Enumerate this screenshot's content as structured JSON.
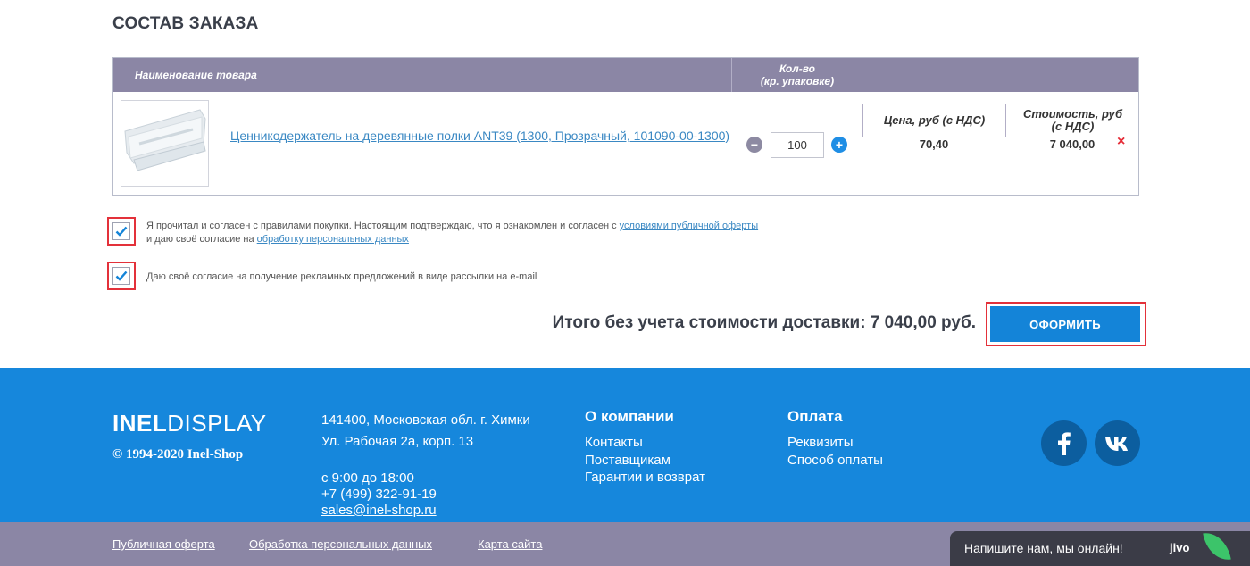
{
  "order": {
    "title": "СОСТАВ ЗАКАЗА",
    "columns": {
      "name": "Наименование товара",
      "qty": "Кол-во\n(кр. упаковке)",
      "price": "Цена, руб (с НДС)",
      "cost": "Стоимость, руб\n(с НДС)"
    },
    "items": [
      {
        "name": "Ценникодержатель на деревянные полки ANT39 (1300, Прозрачный, 101090-00-1300)",
        "qty": "100",
        "qty_minus": "−",
        "qty_plus": "+",
        "price": "70,40",
        "cost": "7 040,00",
        "remove": "×"
      }
    ]
  },
  "agreements": {
    "terms_text_1": "Я прочитал и согласен с правилами покупки. Настоящим подтверждаю, что я ознакомлен и согласен с ",
    "terms_link_1": "условиями публичной оферты",
    "terms_text_2": "и даю своё согласие на ",
    "terms_link_2": "обработку персональных данных",
    "terms_checked": true,
    "newsletter_text": "Даю своё согласие на получение рекламных предложений в виде рассылки на e-mail",
    "newsletter_checked": true
  },
  "summary": {
    "total": "Итого без учета стоимости доставки: 7 040,00 руб.",
    "submit_label": "ОФОРМИТЬ"
  },
  "footer": {
    "logo_bold": "INEL",
    "logo_light": "DISPLAY",
    "copyright": "© 1994-2020 Inel-Shop",
    "address_line1": "141400, Московская обл. г. Химки",
    "address_line2": "Ул. Рабочая 2а, корп. 13",
    "hours": "с 9:00 до 18:00",
    "phone": "+7 (499) 322-91-19",
    "email": "sales@inel-shop.ru",
    "company": {
      "title": "О компании",
      "links": [
        "Контакты",
        "Поставщикам",
        "Гарантии и возврат"
      ]
    },
    "payment": {
      "title": "Оплата",
      "links": [
        "Реквизиты",
        "Способ оплаты"
      ]
    },
    "social": [
      "facebook-icon",
      "vk-icon"
    ]
  },
  "bottom_bar": {
    "links": [
      "Публичная оферта",
      "Обработка персональных данных",
      "Карта сайта"
    ]
  },
  "chat": {
    "text": "Напишите нам, мы онлайн!",
    "brand": "jivo"
  },
  "colors": {
    "header_bg": "#8b86a5",
    "accent": "#1484d8",
    "footer_bg": "#1687dc",
    "highlight": "#e3313a",
    "remove": "#e52b36"
  }
}
